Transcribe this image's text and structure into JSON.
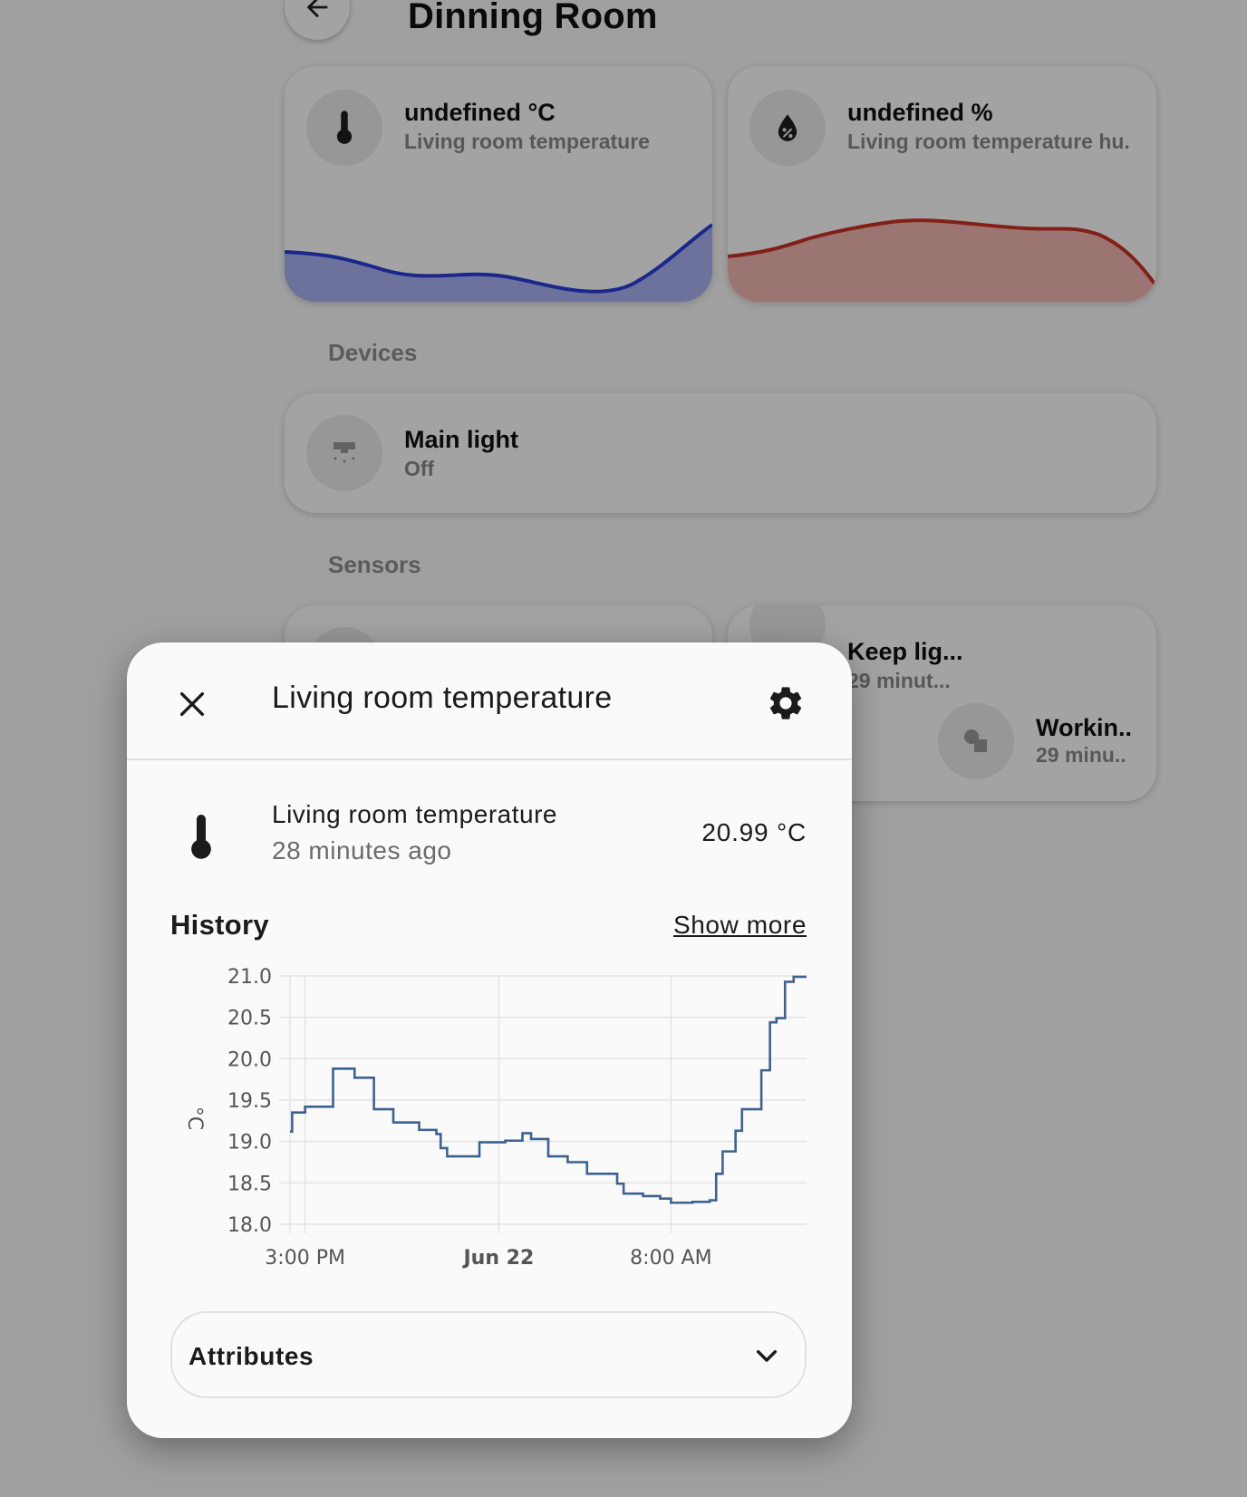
{
  "page": {
    "title": "Dinning Room",
    "back_icon": "arrow-left-icon"
  },
  "summary_cards": [
    {
      "value": "undefined °C",
      "name": "Living room temperature",
      "icon": "thermometer-icon",
      "graph_color": "#2b3ed9"
    },
    {
      "value": "undefined %",
      "name": "Living room temperature hu.",
      "icon": "water-percent-icon",
      "graph_color": "#cc3325"
    }
  ],
  "sections": {
    "devices": "Devices",
    "sensors": "Sensors"
  },
  "devices": [
    {
      "name": "Main light",
      "state": "Off",
      "icon": "ceiling-light-icon"
    }
  ],
  "sensors": [
    {
      "name": "Keep lig...",
      "state": "29 minut..."
    },
    {
      "name": "Workin..",
      "state": "29 minu.."
    }
  ],
  "dialog": {
    "title": "Living room temperature",
    "close_icon": "close-icon",
    "settings_icon": "gear-icon",
    "entity": {
      "name": "Living room temperature",
      "last_changed": "28 minutes ago",
      "value": "20.99 °C",
      "icon": "thermometer-icon"
    },
    "history_title": "History",
    "show_more": "Show more",
    "attributes_label": "Attributes"
  },
  "colors": {
    "accent_line": "#3d6291",
    "temperature_graph": "#2b3ed9",
    "humidity_graph": "#cc3325"
  },
  "chart_data": {
    "type": "line",
    "step": true,
    "ylabel": "°C",
    "ylim": [
      18.0,
      21.0
    ],
    "yticks": [
      "21.0",
      "20.5",
      "20.0",
      "19.5",
      "19.0",
      "18.5",
      "18.0"
    ],
    "xticks": [
      {
        "label": "3:00 PM",
        "bold": false,
        "t": 1.0
      },
      {
        "label": "Jun 22",
        "bold": true,
        "t": 10.0
      },
      {
        "label": "8:00 AM",
        "bold": false,
        "t": 18.0
      }
    ],
    "xlim": [
      0.3,
      24.3
    ],
    "grid": true,
    "series": [
      {
        "color": "#3d6291",
        "x": [
          0.3,
          0.4,
          1.0,
          2.0,
          2.3,
          3.3,
          4.2,
          5.1,
          6.3,
          7.1,
          7.3,
          7.6,
          8.4,
          9.1,
          9.3,
          10.3,
          11.1,
          11.5,
          12.3,
          13.2,
          14.1,
          14.7,
          15.5,
          15.8,
          16.3,
          16.7,
          17.5,
          18.0,
          19.0,
          19.8,
          20.1,
          20.4,
          20.6,
          21.0,
          21.3,
          21.6,
          22.2,
          22.6,
          22.9,
          23.3,
          23.7,
          24.3
        ],
        "y": [
          19.12,
          19.35,
          19.42,
          19.42,
          19.88,
          19.77,
          19.39,
          19.23,
          19.14,
          19.09,
          18.92,
          18.82,
          18.82,
          18.99,
          18.99,
          19.01,
          19.1,
          19.03,
          18.82,
          18.75,
          18.61,
          18.61,
          18.49,
          18.37,
          18.37,
          18.34,
          18.31,
          18.26,
          18.27,
          18.29,
          18.61,
          18.88,
          18.88,
          19.13,
          19.39,
          19.39,
          19.86,
          20.44,
          20.49,
          20.93,
          20.99,
          20.99
        ]
      }
    ]
  }
}
